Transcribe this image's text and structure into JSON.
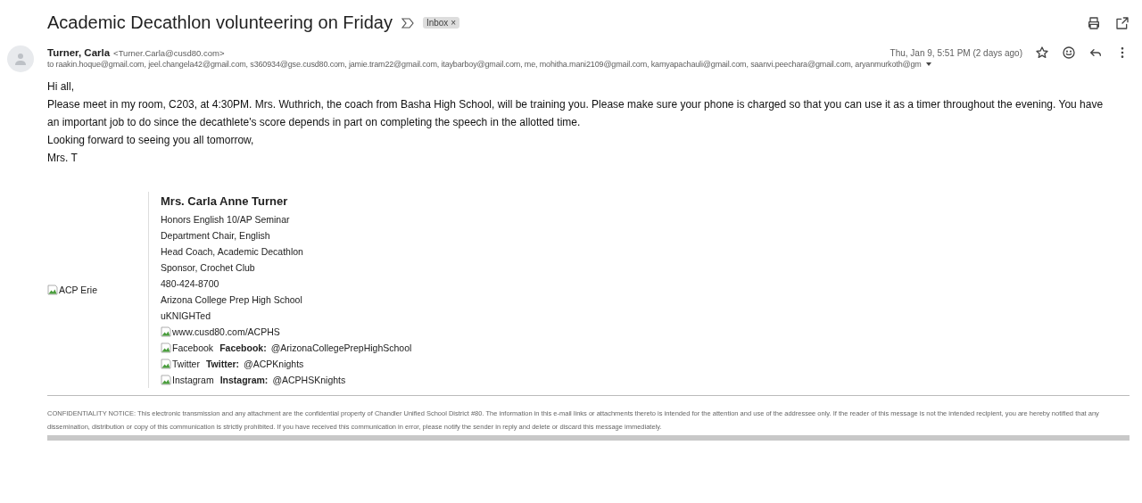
{
  "subject": "Academic Decathlon volunteering on Friday",
  "labels": [
    {
      "text": "Inbox",
      "remove": "×"
    }
  ],
  "message": {
    "sender_name": "Turner, Carla",
    "sender_email": "<Turner.Carla@cusd80.com>",
    "date": "Thu, Jan 9, 5:51 PM (2 days ago)",
    "starred": false,
    "recipients": "to raakin.hoque@gmail.com, jeel.changela42@gmail.com, s360934@gse.cusd80.com, jamie.tram22@gmail.com, itaybarboy@gmail.com, me, mohitha.mani2109@gmail.com, kamyapachauli@gmail.com, saanvi.peechara@gmail.com, aryanmurkoth@gm",
    "body": [
      "Hi all,",
      "Please meet in my room, C203, at 4:30PM. Mrs. Wuthrich, the coach from Basha High School, will be training you. Please make sure your phone is charged so that you can use it as a timer throughout the evening. You have an important job to do since the decathlete's score depends in part on completing the speech in the allotted time.",
      "Looking forward to seeing you all tomorrow,",
      "Mrs. T"
    ]
  },
  "signature": {
    "logo_alt": "ACP Erie",
    "name": "Mrs. Carla Anne Turner",
    "lines": [
      "Honors English 10/AP Seminar",
      "Department Chair, English",
      "Head Coach, Academic Decathlon",
      "Sponsor, Crochet Club",
      "480-424-8700",
      "Arizona College Prep High School",
      "uKNIGHTed"
    ],
    "links": [
      {
        "alt": "www.cusd80.com/ACPHS"
      },
      {
        "alt": "Facebook",
        "label": "Facebook:",
        "handle": "@ArizonaCollegePrepHighSchool"
      },
      {
        "alt": "Twitter",
        "label": "Twitter:",
        "handle": "@ACPKnights"
      },
      {
        "alt": "Instagram",
        "label": "Instagram:",
        "handle": "@ACPHSKnights"
      }
    ]
  },
  "notice": "CONFIDENTIALITY NOTICE: This electronic transmission and any attachment are the confidential property of Chandler Unified School District #80. The information in this e-mail links or attachments thereto is intended for the attention and use of the addressee only. If the reader of this message is not the intended recipient, you are hereby notified that any dissemination, distribution or copy of this communication is strictly prohibited. If you have received this communication in error, please notify the sender in reply and delete or discard this message immediately."
}
